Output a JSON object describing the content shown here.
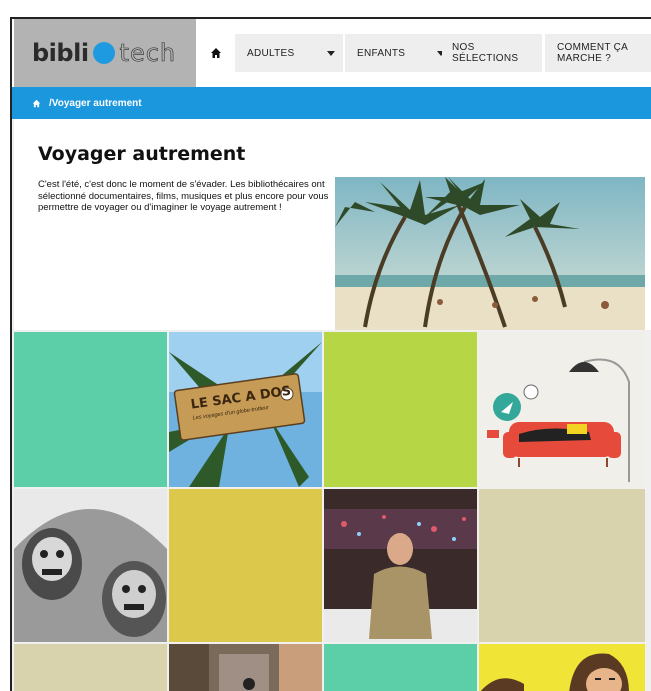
{
  "logo": {
    "part1": "bibli",
    "part2": "tech"
  },
  "nav": {
    "adultes": "ADULTES",
    "enfants": "ENFANTS",
    "selections_line1": "NOS",
    "selections_line2": "SÉLECTIONS",
    "comment_line1": "COMMENT ÇA",
    "comment_line2": "MARCHE ?"
  },
  "breadcrumb": {
    "separator": "/",
    "current": "Voyager autrement"
  },
  "page": {
    "title": "Voyager autrement",
    "description": "C'est l'été, c'est donc le moment de s'évader. Les bibliothécaires ont sélectionné documentaires, films, musiques et plus encore pour vous permettre de voyager ou d'imaginer le voyage autrement !"
  },
  "tiles": {
    "sac_a_dos_title": "LE SAC A DOS",
    "sac_a_dos_subtitle": "Les voyages d'un globe-trotteur"
  },
  "colors": {
    "accent_blue": "#1b98dd",
    "tile_teal": "#5ccfa8",
    "tile_lime": "#b7d645",
    "tile_yellow": "#dcc84a",
    "tile_beige": "#d8d3ac",
    "tile_bright_yellow": "#f0e437"
  }
}
